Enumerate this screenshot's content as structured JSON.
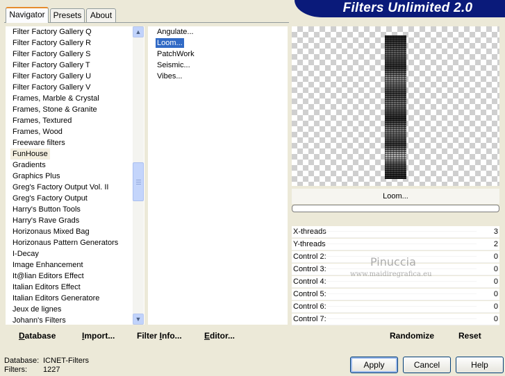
{
  "tabs": [
    {
      "label": "Navigator",
      "active": true
    },
    {
      "label": "Presets",
      "active": false
    },
    {
      "label": "About",
      "active": false
    }
  ],
  "title": "Filters Unlimited 2.0",
  "categories": [
    "Filter Factory Gallery Q",
    "Filter Factory Gallery R",
    "Filter Factory Gallery S",
    "Filter Factory Gallery T",
    "Filter Factory Gallery U",
    "Filter Factory Gallery V",
    "Frames, Marble & Crystal",
    "Frames, Stone & Granite",
    "Frames, Textured",
    "Frames, Wood",
    "Freeware filters",
    "FunHouse",
    "Gradients",
    "Graphics Plus",
    "Greg's Factory Output Vol. II",
    "Greg's Factory Output",
    "Harry's Button Tools",
    "Harry's Rave Grads",
    "Horizonaus Mixed Bag",
    "Horizonaus Pattern Generators",
    "I-Decay",
    "Image Enhancement",
    "It@lian Editors Effect",
    "Italian Editors Effect",
    "Italian Editors Generatore",
    "Jeux de lignes",
    "Johann's Filters"
  ],
  "selected_category": "FunHouse",
  "filters": [
    "Angulate...",
    "Loom...",
    "PatchWork",
    "Seismic...",
    "Vibes..."
  ],
  "selected_filter": "Loom...",
  "preview_filter_name": "Loom...",
  "controls": [
    {
      "label": "X-threads",
      "value": "3"
    },
    {
      "label": "Y-threads",
      "value": "2"
    },
    {
      "label": "Control 2:",
      "value": "0"
    },
    {
      "label": "Control 3:",
      "value": "0"
    },
    {
      "label": "Control 4:",
      "value": "0"
    },
    {
      "label": "Control 5:",
      "value": "0"
    },
    {
      "label": "Control 6:",
      "value": "0"
    },
    {
      "label": "Control 7:",
      "value": "0"
    }
  ],
  "watermark": {
    "name": "Pinuccia",
    "url": "www.maidiregrafica.eu"
  },
  "toolbar": {
    "database": {
      "u": "D",
      "rest": "atabase"
    },
    "import": {
      "u": "I",
      "rest": "mport..."
    },
    "filter_info": {
      "pre": "Filter ",
      "u": "I",
      "rest": "nfo..."
    },
    "editor": {
      "u": "E",
      "rest": "ditor..."
    },
    "randomize": "Randomize",
    "reset": "Reset"
  },
  "status": {
    "database_label": "Database:",
    "database_value": "ICNET-Filters",
    "filters_label": "Filters:",
    "filters_value": "1227"
  },
  "buttons": {
    "apply": "Apply",
    "cancel": "Cancel",
    "help": "Help"
  },
  "colors": {
    "banner": "#0a1a7a",
    "selection": "#316ac5"
  }
}
